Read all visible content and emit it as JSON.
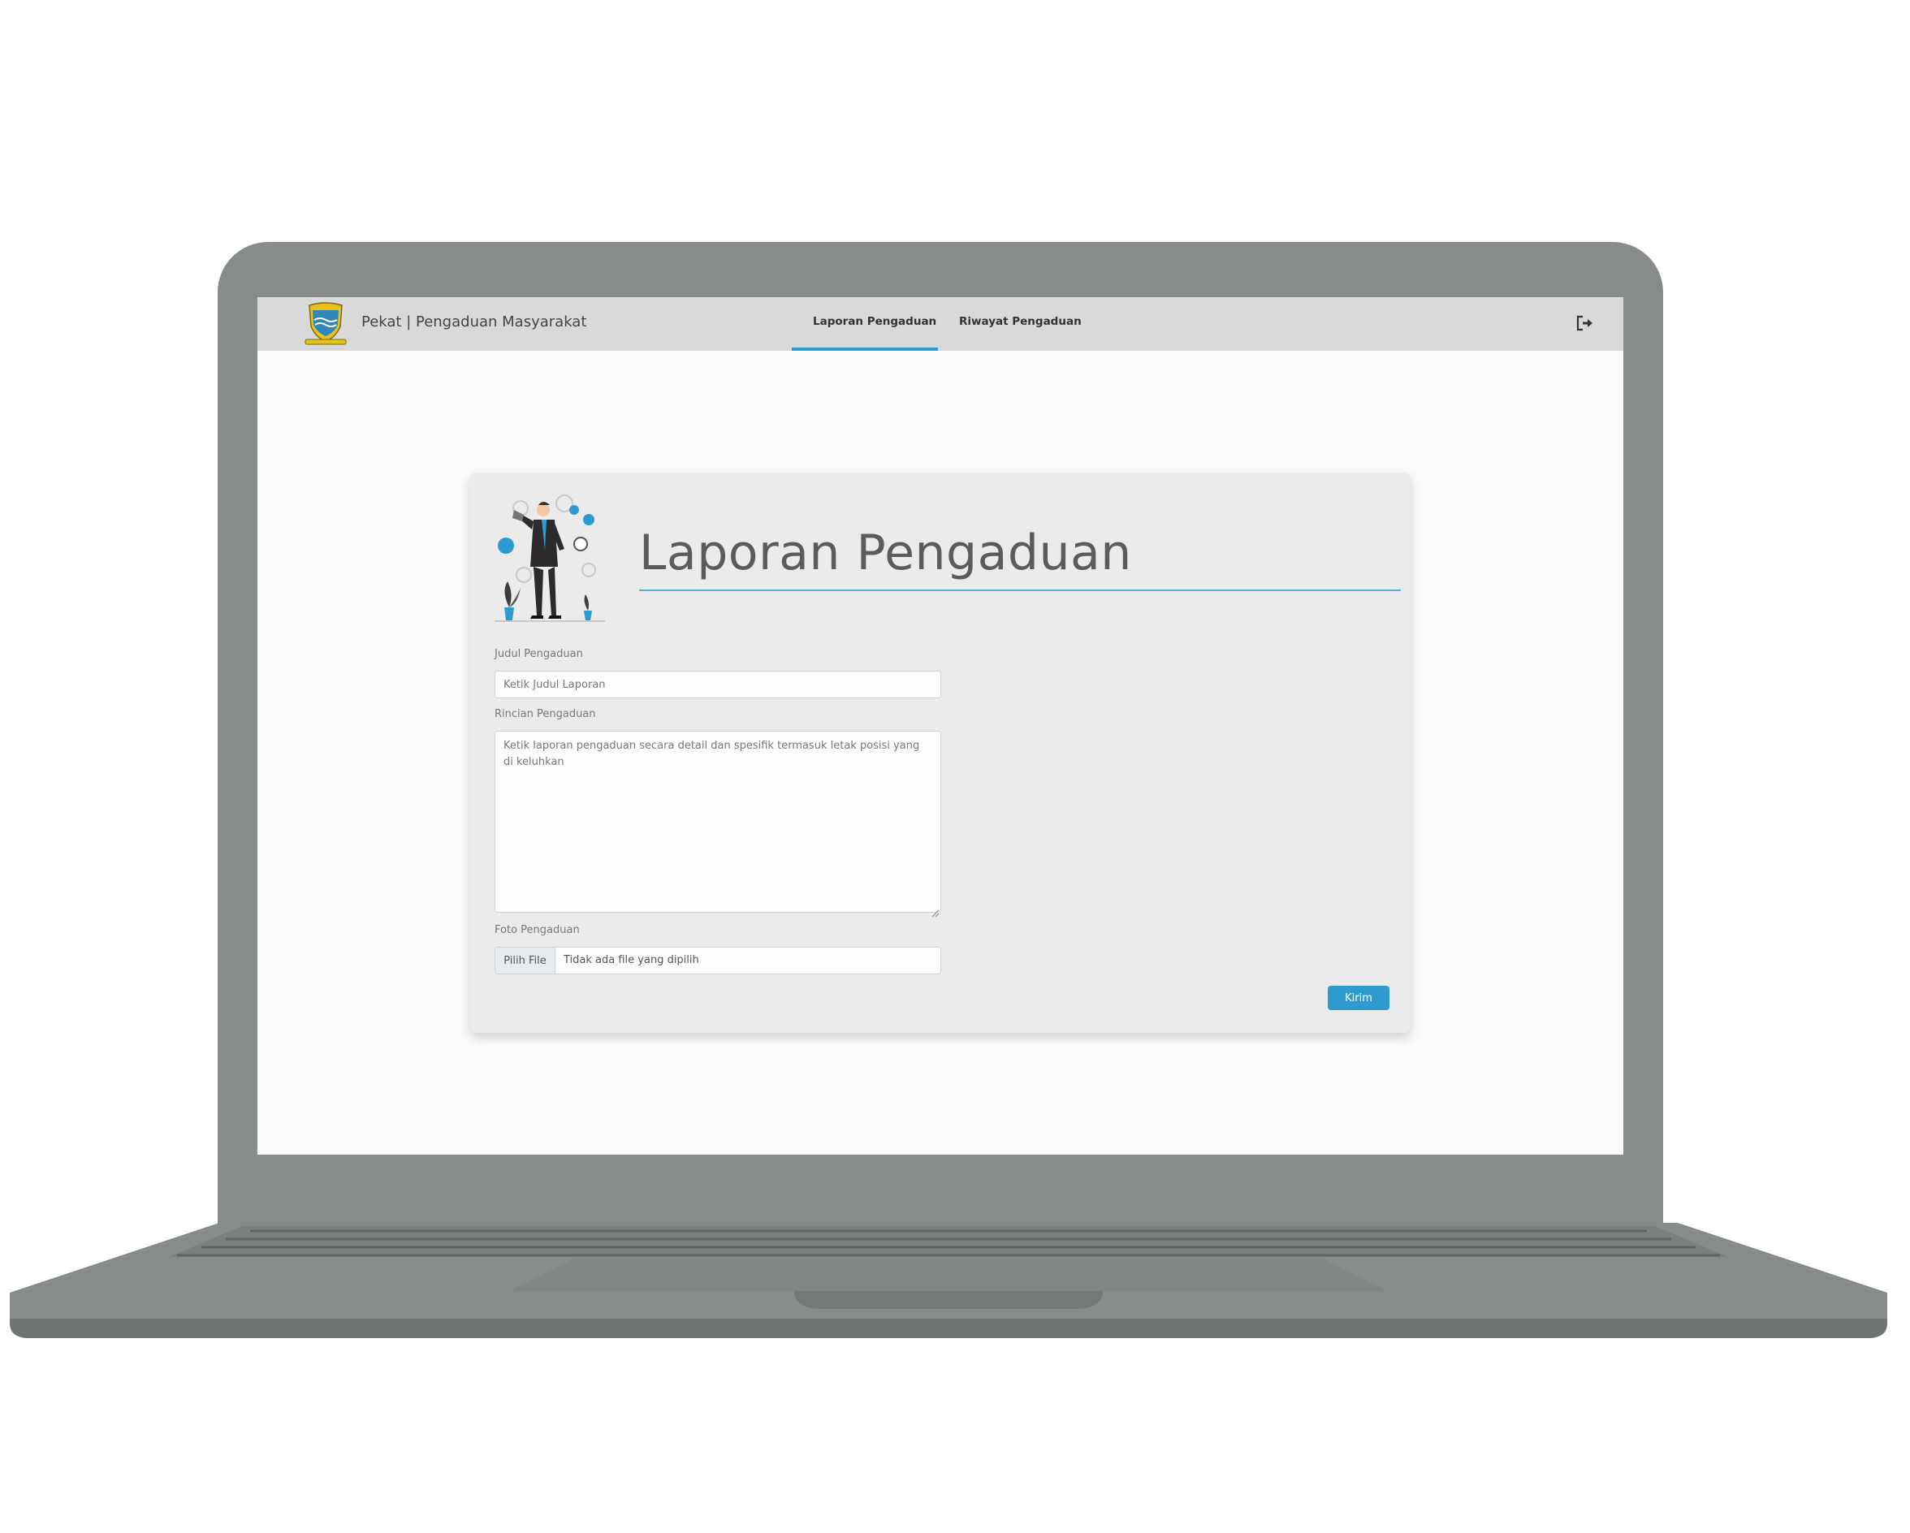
{
  "navbar": {
    "brand": "Pekat | Pengaduan Masyarakat",
    "links": [
      {
        "label": "Laporan Pengaduan",
        "active": true
      },
      {
        "label": "Riwayat Pengaduan",
        "active": false
      }
    ],
    "logout_icon": "sign-out-icon"
  },
  "form": {
    "title": "Laporan Pengaduan",
    "judul": {
      "label": "Judul Pengaduan",
      "placeholder": "Ketik Judul Laporan",
      "value": ""
    },
    "rincian": {
      "label": "Rincian Pengaduan",
      "placeholder": "Ketik laporan pengaduan secara detail dan spesifik termasuk letak posisi yang di keluhkan",
      "value": ""
    },
    "foto": {
      "label": "Foto Pengaduan",
      "button": "Pilih File",
      "status": "Tidak ada file yang dipilih"
    },
    "submit": "Kirim"
  },
  "colors": {
    "accent": "#2e9bd0",
    "navbar_bg": "#d9d9d9",
    "card_bg": "#ebebeb",
    "laptop_body": "#878b8b"
  }
}
